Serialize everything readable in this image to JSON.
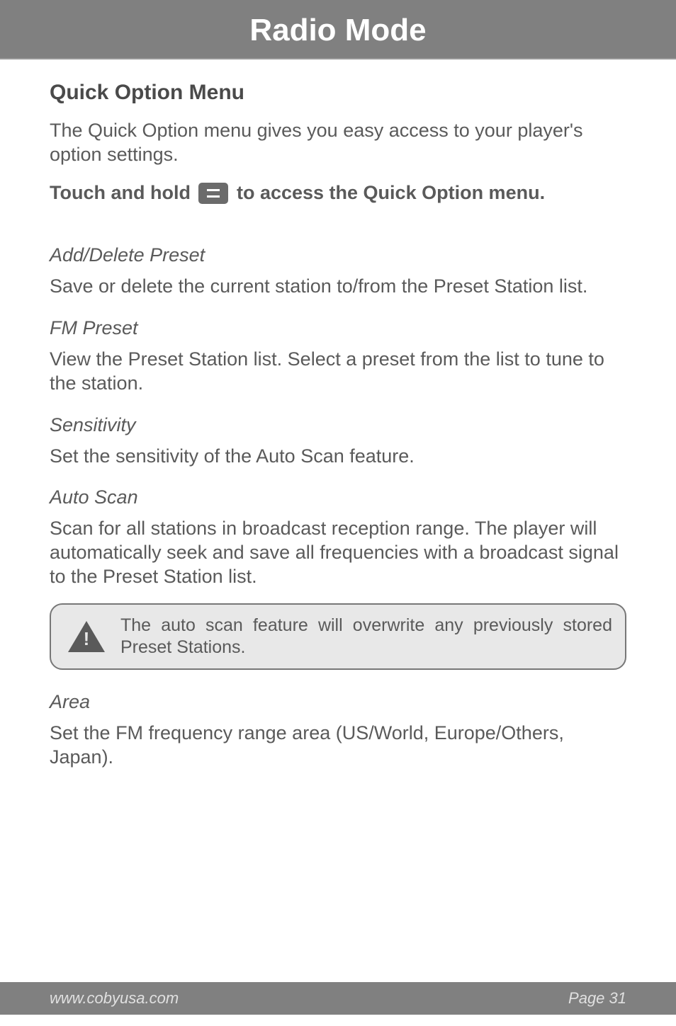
{
  "header": {
    "title": "Radio Mode"
  },
  "section": {
    "heading": "Quick Option Menu",
    "intro": "The Quick Option menu gives you easy access to your player's option settings.",
    "instruction_prefix": "Touch and hold ",
    "instruction_suffix": " to access the Quick Option menu.",
    "items": [
      {
        "title": "Add/Delete Preset",
        "body": "Save or delete the current station to/from the Preset Station list."
      },
      {
        "title": "FM Preset",
        "body": "View the Preset Station list. Select a preset from the list to tune to the station."
      },
      {
        "title": "Sensitivity",
        "body": "Set the sensitivity of the Auto Scan feature."
      },
      {
        "title": "Auto Scan",
        "body": "Scan for all stations in broadcast reception range. The player will automatically seek and save all frequencies with a broadcast signal to the Preset Station list."
      }
    ],
    "callout": "The auto scan feature will overwrite any previously stored Preset Stations.",
    "area": {
      "title": "Area",
      "body": "Set the FM frequency range area (US/World, Europe/Others, Japan)."
    }
  },
  "footer": {
    "url": "www.cobyusa.com",
    "page": "Page 31"
  }
}
